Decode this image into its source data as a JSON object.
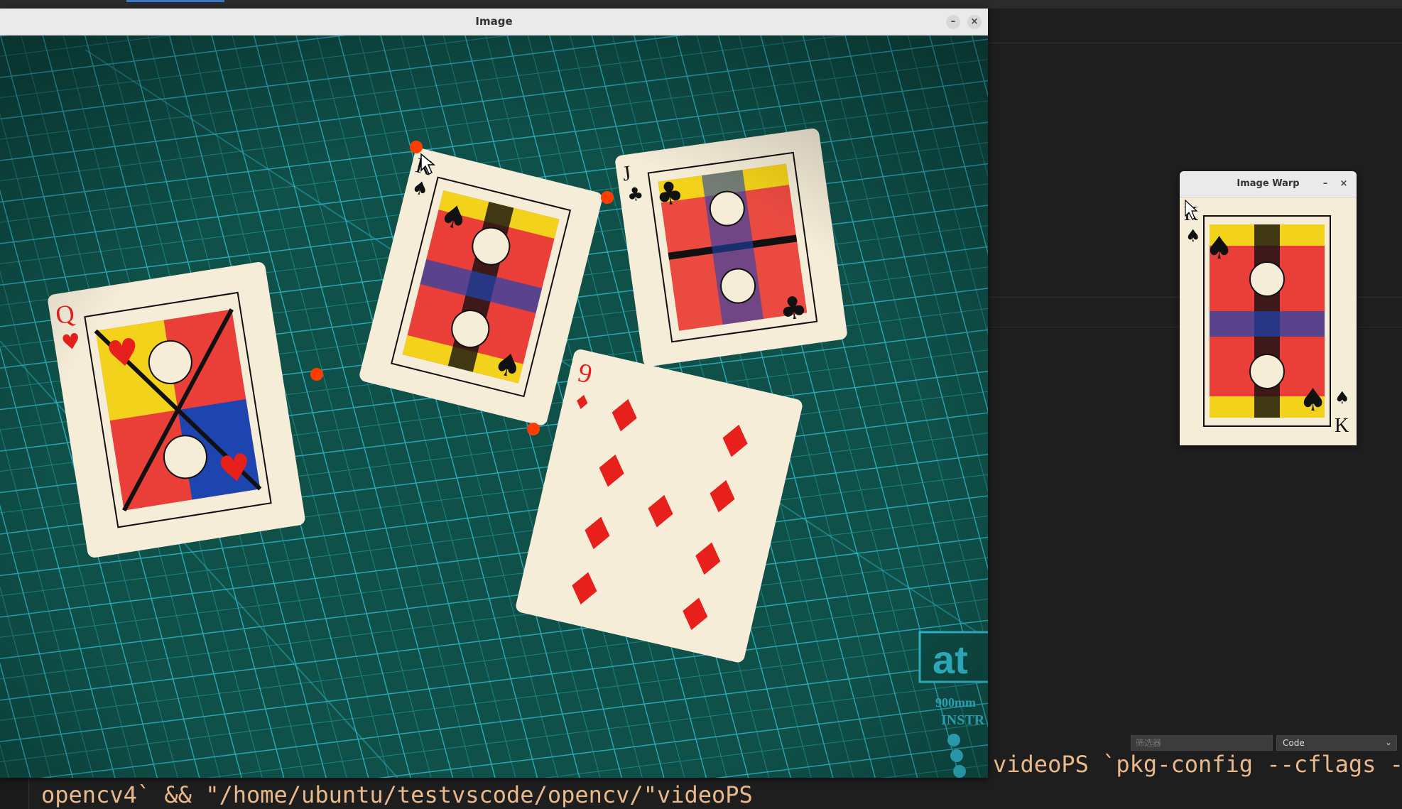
{
  "image_window": {
    "title": "Image",
    "minimize": "–",
    "close": "×"
  },
  "warp_window": {
    "title": "Image Warp",
    "minimize": "–",
    "close": "×"
  },
  "ide": {
    "filter_placeholder": "筛选器",
    "output_channel": "Code"
  },
  "terminal": {
    "line1": "videoPS `pkg-config --cflags -",
    "line2": "opencv4` && \"/home/ubuntu/testvscode/opencv/\"videoPS"
  },
  "cards": {
    "queen_hearts": {
      "rank": "Q",
      "suit": "♥"
    },
    "king_spades": {
      "rank": "K",
      "suit": "♠"
    },
    "jack_clubs": {
      "rank": "J",
      "suit": "♣"
    },
    "nine_diamonds": {
      "rank": "9",
      "suit": "♦"
    }
  },
  "mat_text": {
    "logo": "at",
    "size": "900mm",
    "instr": "INSTR"
  },
  "colors": {
    "mat": "#0f5049",
    "grid": "#2fb5c8",
    "marker": "#ff3d00",
    "card": "#f5edd8",
    "red_suit": "#e8201c"
  }
}
